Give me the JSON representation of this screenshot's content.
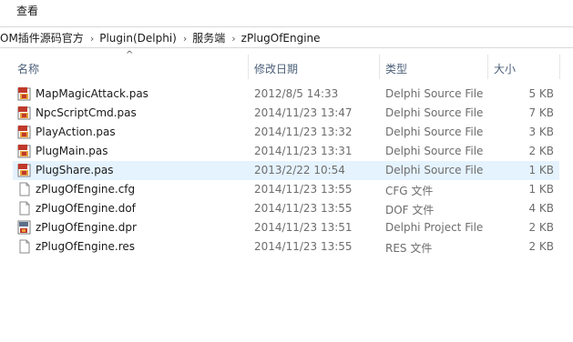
{
  "menu": {
    "view_label": "查看"
  },
  "breadcrumb": [
    "OM插件源码官方",
    "Plugin(Delphi)",
    "服务端",
    "zPlugOfEngine"
  ],
  "columns": {
    "name": "名称",
    "date": "修改日期",
    "type": "类型",
    "size": "大小"
  },
  "files": [
    {
      "name": "MapMagicAttack.pas",
      "date": "2012/8/5 14:33",
      "type": "Delphi Source File",
      "size": "5 KB",
      "icon": "delphi-source-icon"
    },
    {
      "name": "NpcScriptCmd.pas",
      "date": "2014/11/23 13:47",
      "type": "Delphi Source File",
      "size": "7 KB",
      "icon": "delphi-source-icon"
    },
    {
      "name": "PlayAction.pas",
      "date": "2014/11/23 13:32",
      "type": "Delphi Source File",
      "size": "3 KB",
      "icon": "delphi-source-icon"
    },
    {
      "name": "PlugMain.pas",
      "date": "2014/11/23 13:31",
      "type": "Delphi Source File",
      "size": "2 KB",
      "icon": "delphi-source-icon"
    },
    {
      "name": "PlugShare.pas",
      "date": "2013/2/22 10:54",
      "type": "Delphi Source File",
      "size": "1 KB",
      "icon": "delphi-source-icon",
      "selected": true
    },
    {
      "name": "zPlugOfEngine.cfg",
      "date": "2014/11/23 13:55",
      "type": "CFG 文件",
      "size": "1 KB",
      "icon": "document-icon"
    },
    {
      "name": "zPlugOfEngine.dof",
      "date": "2014/11/23 13:55",
      "type": "DOF 文件",
      "size": "4 KB",
      "icon": "document-icon"
    },
    {
      "name": "zPlugOfEngine.dpr",
      "date": "2014/11/23 13:51",
      "type": "Delphi Project File",
      "size": "2 KB",
      "icon": "delphi-project-icon"
    },
    {
      "name": "zPlugOfEngine.res",
      "date": "2014/11/23 13:55",
      "type": "RES 文件",
      "size": "2 KB",
      "icon": "document-icon"
    }
  ]
}
